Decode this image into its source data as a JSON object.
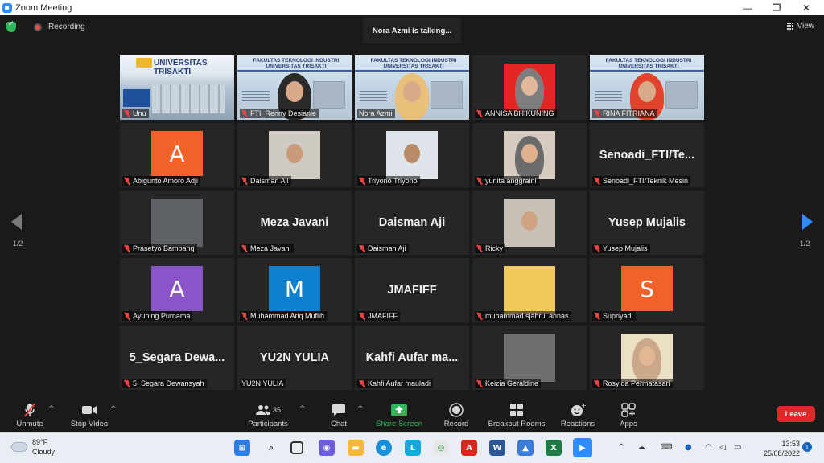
{
  "window": {
    "title": "Zoom Meeting"
  },
  "meeting": {
    "recording_label": "Recording",
    "talking_banner": "Nora Azmi is talking...",
    "view_label": "View",
    "page_left": "1/2",
    "page_right": "1/2"
  },
  "tiles": [
    {
      "name": "Unu",
      "kind": "univ",
      "muted": true,
      "banner_title": "UNIVERSITAS TRISAKTI"
    },
    {
      "name": "FTI_Renny Desianie",
      "kind": "banner",
      "muted": true,
      "banner_title": "FAKULTAS TEKNOLOGI INDUSTRI UNIVERSITAS TRISAKTI"
    },
    {
      "name": "Nora Azmi",
      "kind": "banner",
      "muted": false,
      "active": true,
      "banner_title": "FAKULTAS TEKNOLOGI INDUSTRI UNIVERSITAS TRISAKTI"
    },
    {
      "name": "ANNISA BHIKUNING",
      "kind": "photo",
      "muted": true
    },
    {
      "name": "RINA FITRIANA",
      "kind": "banner",
      "muted": true,
      "banner_title": "FAKULTAS TEKNOLOGI INDUSTRI UNIVERSITAS TRISAKTI"
    },
    {
      "name": "Abigunto Amoro Adji",
      "kind": "letter",
      "letter": "A",
      "color": "#f0622a",
      "muted": true
    },
    {
      "name": "Daisman Aji",
      "kind": "photo",
      "muted": true
    },
    {
      "name": "Triyono Triyono",
      "kind": "photo",
      "muted": true
    },
    {
      "name": "yunita anggraini",
      "kind": "photo",
      "muted": true
    },
    {
      "name": "Senoadi_FTI/Teknik Mesin",
      "kind": "text",
      "display": "Senoadi_FTI/Te...",
      "muted": true
    },
    {
      "name": "Prasetyo Bambang",
      "kind": "photo",
      "muted": true
    },
    {
      "name": "Meza Javani",
      "kind": "text",
      "display": "Meza Javani",
      "muted": true
    },
    {
      "name": "Daisman Aji",
      "kind": "text",
      "display": "Daisman Aji",
      "muted": true
    },
    {
      "name": "Ricky",
      "kind": "photo",
      "muted": true
    },
    {
      "name": "Yusep Mujalis",
      "kind": "text",
      "display": "Yusep Mujalis",
      "muted": true
    },
    {
      "name": "Ayuning Purnama",
      "kind": "letter",
      "letter": "A",
      "color": "#8a55c8",
      "muted": true
    },
    {
      "name": "Muhammad Ariq Muflih",
      "kind": "letter",
      "letter": "M",
      "color": "#0f7fd0",
      "muted": true
    },
    {
      "name": "JMAFIFF",
      "kind": "text",
      "display": "JMAFIFF",
      "muted": true
    },
    {
      "name": "muhammad sjahrul annas",
      "kind": "photo",
      "muted": true
    },
    {
      "name": "Supriyadi",
      "kind": "letter",
      "letter": "S",
      "color": "#f0622a",
      "muted": true
    },
    {
      "name": "5_Segara Dewansyah",
      "kind": "text",
      "display": "5_Segara  Dewa...",
      "muted": true
    },
    {
      "name": "YU2N YULIA",
      "kind": "text",
      "display": "YU2N YULIA",
      "muted": false
    },
    {
      "name": "Kahfi Aufar mauladi",
      "kind": "text",
      "display": "Kahfi Aufar ma...",
      "muted": true
    },
    {
      "name": "Keizia Geraldine",
      "kind": "photo",
      "muted": true
    },
    {
      "name": "Rosyida Permatasari",
      "kind": "photo",
      "muted": true
    }
  ],
  "toolbar": {
    "unmute": "Unmute",
    "stop_video": "Stop Video",
    "participants": "Participants",
    "participants_count": "35",
    "chat": "Chat",
    "share_screen": "Share Screen",
    "record": "Record",
    "breakout": "Breakout Rooms",
    "reactions": "Reactions",
    "apps": "Apps",
    "leave": "Leave",
    "share_color": "#2fb65a",
    "leave_color": "#e02828"
  },
  "taskbar": {
    "temp": "89°F",
    "weather": "Cloudy",
    "time": "13:53",
    "date": "25/08/2022",
    "notifications": "1"
  }
}
